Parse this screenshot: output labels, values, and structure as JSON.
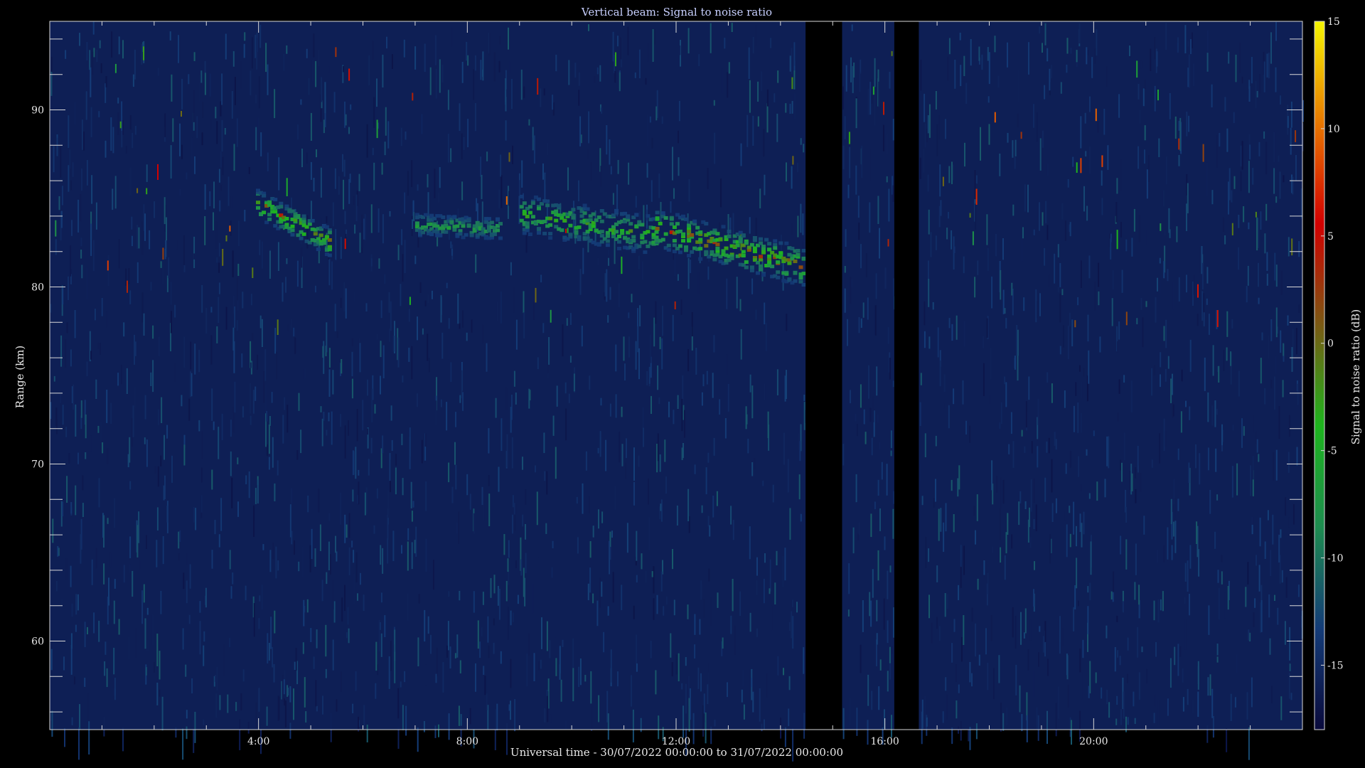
{
  "chart_data": {
    "type": "heatmap",
    "title": "Vertical beam: Signal to noise ratio",
    "xlabel": "Universal time - 30/07/2022 00:00:00 to 31/07/2022 00:00:00",
    "ylabel": "Range (km)",
    "colorbar_label": "Signal to noise ratio (dB)",
    "xlim": [
      0,
      24
    ],
    "ylim": [
      55,
      95
    ],
    "x_ticks": [
      {
        "value": 4,
        "label": "4:00"
      },
      {
        "value": 8,
        "label": "8:00"
      },
      {
        "value": 12,
        "label": "12:00"
      },
      {
        "value": 16,
        "label": "16:00"
      },
      {
        "value": 20,
        "label": "20:00"
      }
    ],
    "y_ticks": [
      {
        "value": 60,
        "label": "60"
      },
      {
        "value": 70,
        "label": "70"
      },
      {
        "value": 80,
        "label": "80"
      },
      {
        "value": 90,
        "label": "90"
      }
    ],
    "colorbar_range": [
      -18,
      15
    ],
    "colorbar_ticks": [
      {
        "value": 15,
        "label": "15"
      },
      {
        "value": 10,
        "label": "10"
      },
      {
        "value": 5,
        "label": "5"
      },
      {
        "value": 0,
        "label": "0"
      },
      {
        "value": -5,
        "label": "-5"
      },
      {
        "value": -10,
        "label": "-10"
      },
      {
        "value": -15,
        "label": "-15"
      }
    ],
    "colormap": [
      "#0a0a3c",
      "#143c78",
      "#1e8c50",
      "#1eb41e",
      "#7a5a14",
      "#d20000",
      "#e87800",
      "#f5f500"
    ],
    "background_level_db": -16,
    "data_gaps_hours": [
      [
        14.48,
        15.18
      ],
      [
        16.18,
        16.65
      ]
    ],
    "echo_layers": [
      {
        "t_start": 3.95,
        "t_end": 5.35,
        "range_start": 84.8,
        "range_end": 82.6,
        "thickness_km": 1.6,
        "peak_db": 2
      },
      {
        "t_start": 7.0,
        "t_end": 8.6,
        "range_start": 83.6,
        "range_end": 83.4,
        "thickness_km": 1.2,
        "peak_db": -6
      },
      {
        "t_start": 9.0,
        "t_end": 11.6,
        "range_start": 84.2,
        "range_end": 83.0,
        "thickness_km": 2.2,
        "peak_db": -3
      },
      {
        "t_start": 11.6,
        "t_end": 14.45,
        "range_start": 83.4,
        "range_end": 81.2,
        "thickness_km": 2.2,
        "peak_db": 2
      }
    ]
  }
}
